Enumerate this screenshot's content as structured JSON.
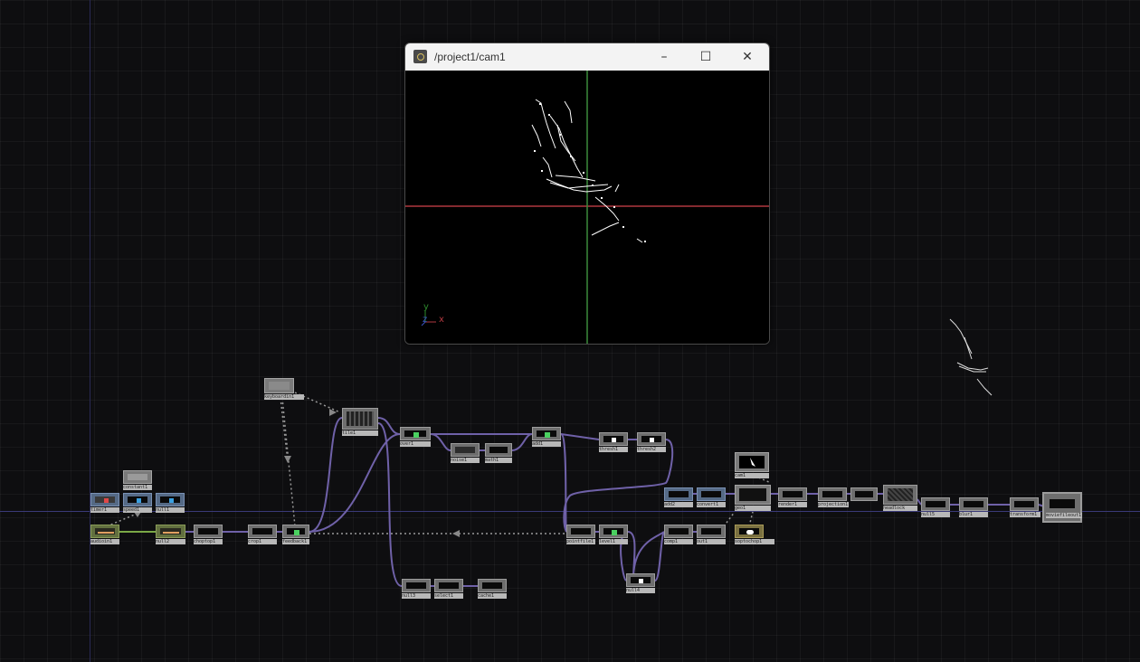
{
  "viewer": {
    "title": "/project1/cam1",
    "minimize": "–",
    "maximize": "☐",
    "close": "✕",
    "axis_labels": {
      "y": "y",
      "z": "z",
      "x": "x"
    }
  },
  "nodes": {
    "keyboardin": "keyboardin1",
    "constant": "constant1",
    "timer": "timer1",
    "speed": "speed1",
    "null_top": "null1",
    "audio": "audioin1",
    "null2": "null2",
    "chopto": "choptop1",
    "crop": "crop1",
    "feedback": "feedback1",
    "tile": "tile1",
    "over": "over1",
    "noise": "noise1",
    "math": "math1",
    "add": "add1",
    "threshold": "thresh1",
    "thresh2": "thresh2",
    "null3": "null3",
    "select": "select1",
    "cache": "cache1",
    "point": "pointfile1",
    "level": "level1",
    "null4": "null4",
    "comp1": "comp1",
    "out": "out1",
    "sopto": "soptochop1",
    "add2": "add2",
    "convert": "convert1",
    "geo": "geo1",
    "render": "render1",
    "camera": "cam1",
    "projection": "projection1",
    "headlock": "headlock",
    "null5": "null5",
    "blur": "blur1",
    "transform": "transform1",
    "moviefileout": "moviefileout1"
  },
  "icons": {
    "app": "touchdesigner-icon",
    "minimize": "minimize-icon",
    "maximize": "maximize-icon",
    "close": "close-icon"
  },
  "colors": {
    "wire": "#6f61a8",
    "background": "#0e0e10",
    "chop": "#556a86",
    "sop": "#62703f",
    "selected": "#2bd14a",
    "x_axis": "#b0383f",
    "y_axis": "#3c8a3c"
  }
}
